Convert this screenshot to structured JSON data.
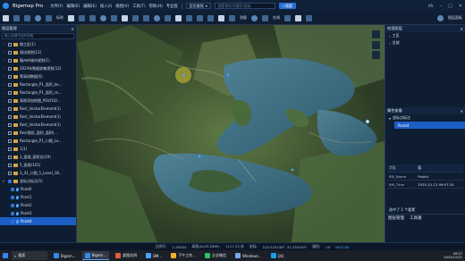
{
  "app": {
    "title": "Bigemap Pro",
    "menus": [
      "文件(F)",
      "编辑(E)",
      "编辑(E)",
      "插入(I)",
      "视图(V)",
      "工具(T)",
      "帮助(H)",
      "专业版"
    ],
    "view_label": "地图",
    "search_placeholder": "搜索地名/关键字/坐标",
    "search_button": "搜索",
    "location_label": "定位查找",
    "user_label": "zh"
  },
  "toolbar": {
    "draw_label": "标绘",
    "measure_label": "测量",
    "online_label": "在线",
    "panels_label": "图层面板"
  },
  "left_panel": {
    "title": "图层管理",
    "filter_placeholder": "输入关键字回车搜索",
    "layers": [
      {
        "label": "微工区(1)",
        "expanded": false,
        "checked": false
      },
      {
        "label": "测试规划(12)",
        "expanded": false,
        "checked": false
      },
      {
        "label": "赣州市城市规划(1)",
        "expanded": false,
        "checked": false
      },
      {
        "label": "2024年数据收集规划(12)",
        "expanded": false,
        "checked": false
      },
      {
        "label": "等高线数据(6)",
        "expanded": false,
        "checked": false
      },
      {
        "label": "Rectangle_P1_面积_ke...",
        "expanded": false,
        "checked": false
      },
      {
        "label": "Rectangle_P1_面积_ra...",
        "expanded": false,
        "checked": false
      },
      {
        "label": "表格添加地图_POLYGO...",
        "expanded": false,
        "checked": false
      },
      {
        "label": "Rect_VectorElement(1)",
        "expanded": false,
        "checked": false
      },
      {
        "label": "Rect_VectorElement(1)",
        "expanded": false,
        "checked": false
      },
      {
        "label": "Rect_VectorElement(1)",
        "expanded": false,
        "checked": false
      },
      {
        "label": "Rect图形_面积_面积(...",
        "expanded": false,
        "checked": false
      },
      {
        "label": "Rectangle_P1_口图_Le...",
        "expanded": false,
        "checked": false
      },
      {
        "label": "1(1)",
        "expanded": false,
        "checked": false
      },
      {
        "label": "1_面规_面积边(19)",
        "expanded": false,
        "checked": false
      },
      {
        "label": "5_面规(101)",
        "expanded": false,
        "checked": false
      },
      {
        "label": "3_41_口图_1_Level_18...",
        "expanded": false,
        "checked": false
      },
      {
        "label": "坐标点标注(5)",
        "expanded": true,
        "checked": true
      }
    ],
    "points": [
      "Point0",
      "Point1",
      "Point2",
      "Point3",
      "Point4"
    ],
    "selected_point": "Point4"
  },
  "right_panel": {
    "title": "档案图层",
    "tree": [
      "工区",
      "全部"
    ],
    "attr_title": "属性查看",
    "attr_layer": "坐标点标注",
    "attr_selected": "Point4",
    "table_head": [
      "字段",
      "值"
    ],
    "attrs": [
      {
        "k": "BM_Name",
        "v": "Point4"
      },
      {
        "k": "BM_Time",
        "v": "2025-12-12 09:57:24"
      }
    ],
    "footer": "选中了 1 个要素",
    "tabs": [
      "图层管理",
      "工具箱"
    ]
  },
  "status": {
    "scale_label": "比例尺:",
    "scale": "1:30944",
    "elevation": "高程(ALOS DEM):",
    "elevation_value": "1117.23 米",
    "coord_label": "坐标:",
    "coord": "103.525148°, 31.255543°",
    "zoom_label": "级别:",
    "zoom": "15",
    "crs": "WGS 84"
  },
  "taskbar": {
    "search": "搜索",
    "items": [
      "Bigem...",
      "Bigem...",
      "超图实例",
      "BM...",
      "下午工作...",
      "企业微信",
      "Windows...",
      "QQ"
    ],
    "time": "09:57",
    "date": "2025/12/12"
  },
  "colors": {
    "accent": "#2a6fd6",
    "panel": "#0e1d31",
    "water": "#3d6f86"
  }
}
